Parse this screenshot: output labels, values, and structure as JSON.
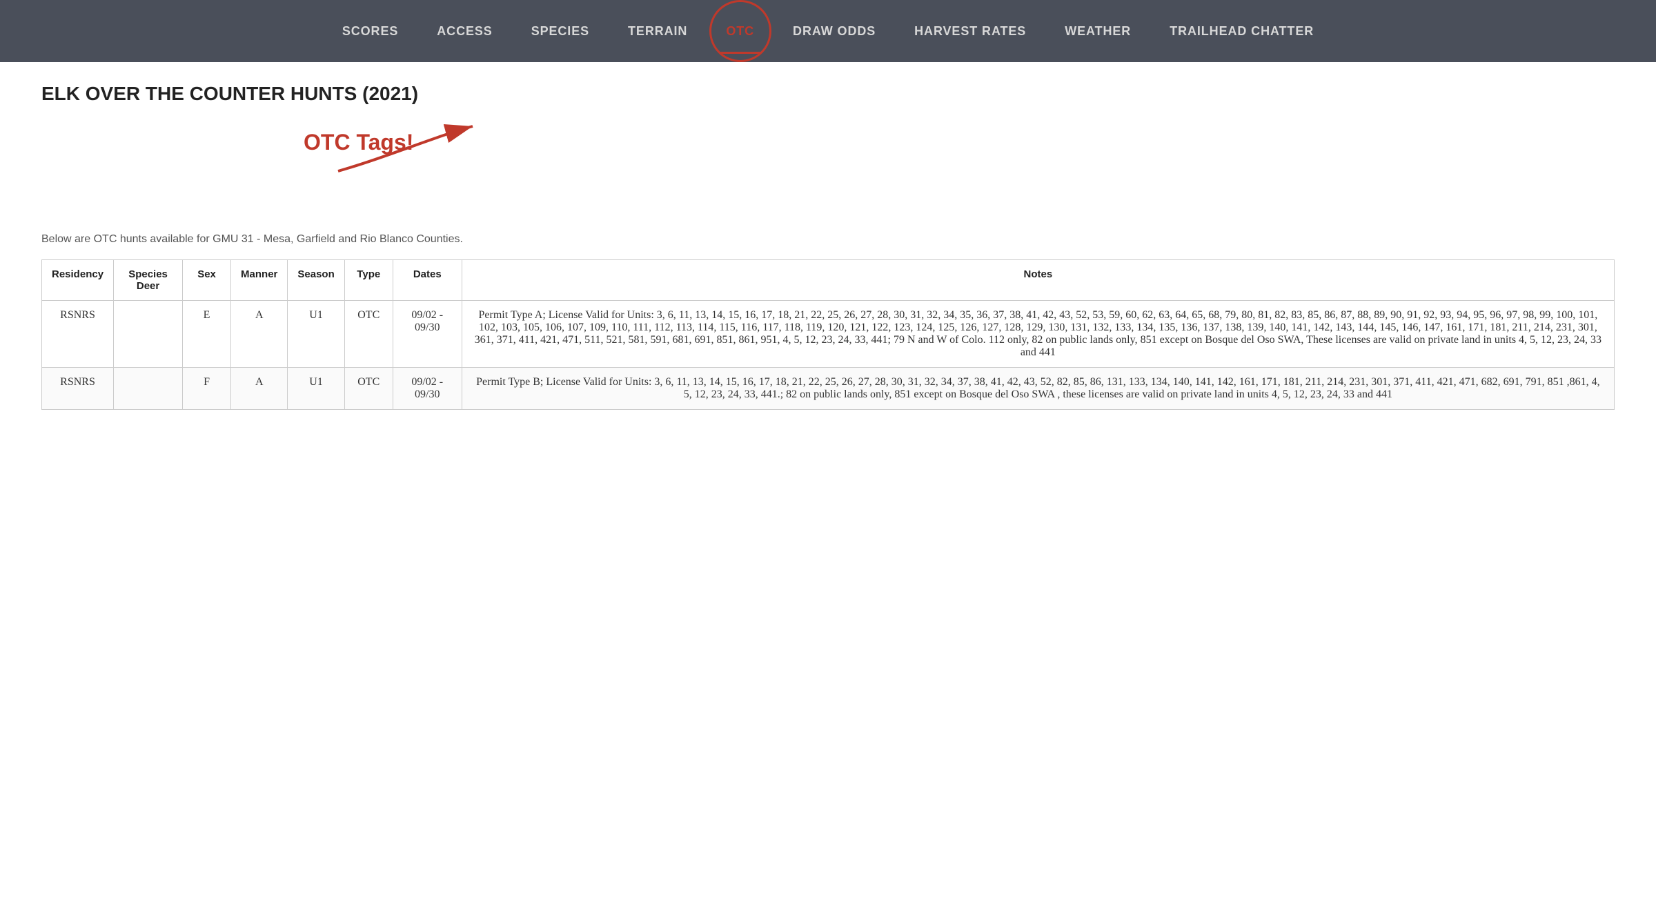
{
  "nav": {
    "items": [
      {
        "label": "SCORES",
        "active": false
      },
      {
        "label": "ACCESS",
        "active": false
      },
      {
        "label": "SPECIES",
        "active": false
      },
      {
        "label": "TERRAIN",
        "active": false
      },
      {
        "label": "OTC",
        "active": true
      },
      {
        "label": "DRAW ODDS",
        "active": false
      },
      {
        "label": "HARVEST RATES",
        "active": false
      },
      {
        "label": "WEATHER",
        "active": false
      },
      {
        "label": "TRAILHEAD CHATTER",
        "active": false
      }
    ]
  },
  "page": {
    "title": "ELK OVER THE COUNTER HUNTS (2021)",
    "subtitle": "Below are OTC hunts available for GMU 31 - Mesa, Garfield and Rio Blanco Counties.",
    "annotation_label": "OTC Tags!"
  },
  "table": {
    "headers": {
      "residency": "Residency",
      "species": "Species\nDeer",
      "sex": "Sex",
      "manner": "Manner",
      "season": "Season",
      "type": "Type",
      "dates": "Dates",
      "notes": "Notes"
    },
    "rows": [
      {
        "residency": "RSNRS",
        "species": "",
        "sex": "E",
        "manner": "A",
        "season": "U1",
        "type": "OTC",
        "dates": "09/02 -\n09/30",
        "notes": "Permit Type A; License Valid for Units: 3, 6, 11, 13, 14, 15, 16, 17, 18, 21, 22, 25, 26, 27, 28, 30, 31, 32, 34, 35, 36, 37, 38, 41, 42, 43, 52, 53, 59, 60, 62, 63, 64, 65, 68, 79, 80, 81, 82, 83, 85, 86, 87, 88, 89, 90, 91, 92, 93, 94, 95, 96, 97, 98, 99, 100, 101, 102, 103, 105, 106, 107, 109, 110, 111, 112, 113, 114, 115, 116, 117, 118, 119, 120, 121, 122, 123, 124, 125, 126, 127, 128, 129, 130, 131, 132, 133, 134, 135, 136, 137, 138, 139, 140, 141, 142, 143, 144, 145, 146, 147, 161, 171, 181, 211, 214, 231, 301, 361, 371, 411, 421, 471, 511, 521, 581, 591, 681, 691, 851, 861, 951, 4, 5, 12, 23, 24, 33, 441; 79 N and W of Colo. 112 only, 82 on public lands only, 851 except on Bosque del Oso SWA, These licenses are valid on private land in units 4, 5, 12, 23, 24, 33 and 441"
      },
      {
        "residency": "RSNRS",
        "species": "",
        "sex": "F",
        "manner": "A",
        "season": "U1",
        "type": "OTC",
        "dates": "09/02 -\n09/30",
        "notes": "Permit Type B; License Valid for Units: 3, 6, 11, 13, 14, 15, 16, 17, 18, 21, 22, 25, 26, 27, 28, 30, 31, 32, 34, 37, 38, 41, 42, 43, 52, 82, 85, 86, 131, 133, 134, 140, 141, 142, 161, 171, 181, 211, 214, 231, 301, 371, 411, 421, 471, 682, 691, 791, 851 ,861, 4, 5, 12, 23, 24, 33, 441.; 82 on public lands only, 851 except on Bosque del Oso SWA , these licenses are valid on private land in units 4, 5, 12, 23, 24, 33 and 441"
      }
    ]
  }
}
